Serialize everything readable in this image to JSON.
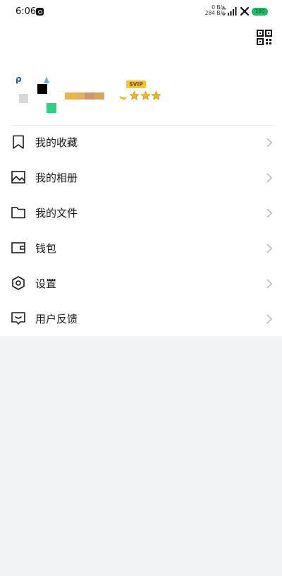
{
  "status_bar": {
    "time": "6:06",
    "net_speed_up": "0 B/s",
    "net_speed_down": "284 B/s",
    "battery": "100"
  },
  "profile": {
    "vip_label": "SVIP",
    "stars": 3,
    "colors": {
      "vip": "#f5c530",
      "star": "#f0b429"
    }
  },
  "menu": {
    "items": [
      {
        "label": "我的收藏",
        "icon": "bookmark-icon"
      },
      {
        "label": "我的相册",
        "icon": "image-icon"
      },
      {
        "label": "我的文件",
        "icon": "folder-icon"
      },
      {
        "label": "钱包",
        "icon": "wallet-icon"
      },
      {
        "label": "设置",
        "icon": "settings-hexagon-icon"
      },
      {
        "label": "用户反馈",
        "icon": "feedback-icon"
      }
    ]
  }
}
